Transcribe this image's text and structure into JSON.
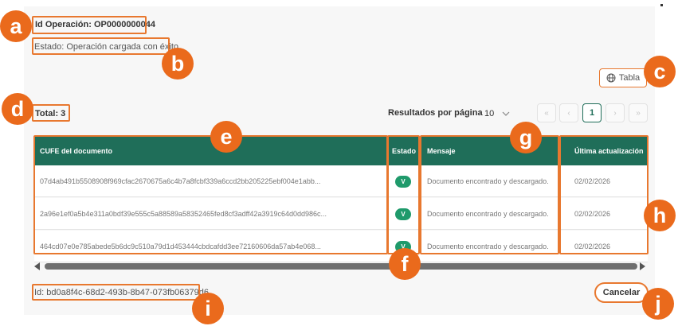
{
  "header": {
    "operation_id": "Id Operación: OP0000000044",
    "state": "Estado: Operación cargada con éxito."
  },
  "view_toggle": {
    "label": "Tabla",
    "icon": "globe-icon"
  },
  "summary": {
    "total": "Total: 3"
  },
  "pagination": {
    "results_per_page_label": "Resultados por página",
    "results_per_page_value": "10",
    "first": "«",
    "prev": "‹",
    "current_page": "1",
    "next": "›",
    "last": "»"
  },
  "table": {
    "columns": [
      "CUFE del documento",
      "Estado",
      "Mensaje",
      "Última actualización"
    ],
    "rows": [
      {
        "cufe": "07d4ab491b5508908f969cfac2670675a6c4b7a8fcbf339a6ccd2bb205225ebf004e1abb...",
        "status": "V",
        "message": "Documento encontrado y descargado.",
        "updated": "02/02/2026"
      },
      {
        "cufe": "2a96e1ef0a5b4e311a0bdf39e555c5a88589a58352465fed8cf3adff42a3919c64d0dd986c...",
        "status": "V",
        "message": "Documento encontrado y descargado.",
        "updated": "02/02/2026"
      },
      {
        "cufe": "464cd07e0e785abede5b6dc9c510a79d1d453444cbdcafdd3ee72160606da57ab4e068...",
        "status": "V",
        "message": "Documento encontrado y descargado.",
        "updated": "02/02/2026"
      }
    ]
  },
  "footer": {
    "id": "Id: bd0a8f4c-68d2-493b-8b47-073fb06379d6",
    "cancel_label": "Cancelar"
  },
  "markers": [
    "a",
    "b",
    "c",
    "d",
    "e",
    "f",
    "g",
    "h",
    "i",
    "j"
  ],
  "colors": {
    "accent": "#e8782f",
    "marker": "#ea6a1c",
    "header": "#1f6e59",
    "status": "#1f9a6b"
  }
}
